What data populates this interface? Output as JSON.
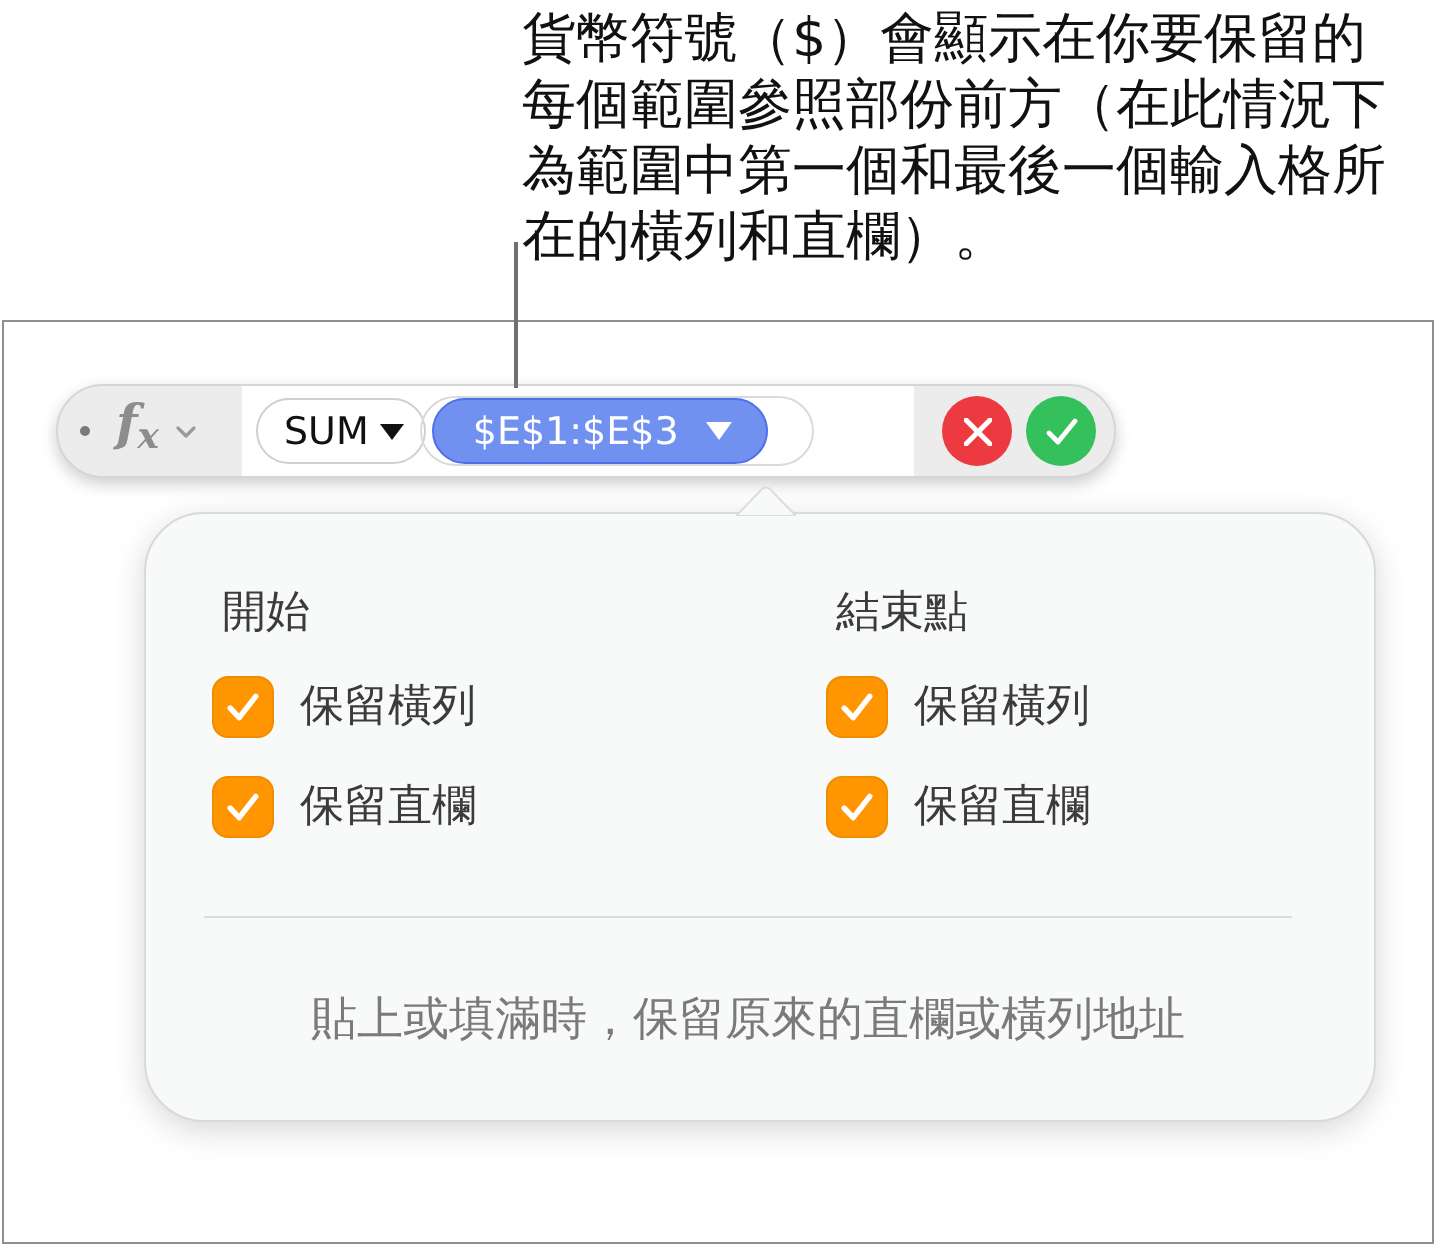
{
  "callout": {
    "text": "貨幣符號（$）會顯示在你要保留的每個範圍參照部份前方（在此情況下為範圍中第一個和最後一個輸入格所在的橫列和直欄）。"
  },
  "formula_bar": {
    "function_label": "f$_{x}$",
    "function_token": "SUM",
    "range_token": {
      "text": "$E$1:$E$3",
      "selected": true
    }
  },
  "popover": {
    "columns": [
      {
        "title": "開始",
        "options": [
          {
            "label": "保留橫列",
            "checked": true
          },
          {
            "label": "保留直欄",
            "checked": true
          }
        ]
      },
      {
        "title": "結束點",
        "options": [
          {
            "label": "保留橫列",
            "checked": true
          },
          {
            "label": "保留直欄",
            "checked": true
          }
        ]
      }
    ],
    "footer_text": "貼上或填滿時，保留原來的直欄或橫列地址"
  }
}
